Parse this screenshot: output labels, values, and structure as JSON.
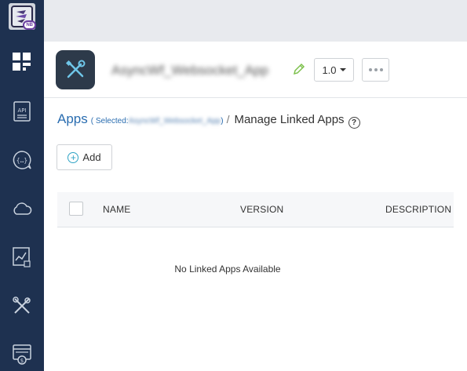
{
  "sidebar": {
    "logo_badge": "NB",
    "items": [
      {
        "icon": "dashboard-icon",
        "label": ""
      },
      {
        "icon": "api-icon",
        "label": "API"
      },
      {
        "icon": "chat-code-icon",
        "label": ""
      },
      {
        "icon": "cloud-icon",
        "label": ""
      },
      {
        "icon": "analytics-icon",
        "label": ""
      },
      {
        "icon": "tools-icon",
        "label": ""
      },
      {
        "icon": "billing-icon",
        "label": ""
      }
    ]
  },
  "app_header": {
    "app_name": "AsyncWf_Websocket_App",
    "version": "1.0"
  },
  "breadcrumb": {
    "root": "Apps",
    "selected_prefix": "( Selected:",
    "selected_value": "AsyncWf_Websocket_App",
    "selected_suffix": ")",
    "separator": "/",
    "current": "Manage Linked Apps",
    "help": "?"
  },
  "toolbar": {
    "add_label": "Add"
  },
  "table": {
    "columns": [
      "NAME",
      "VERSION",
      "DESCRIPTION"
    ],
    "empty_message": "No Linked Apps Available"
  },
  "colors": {
    "sidebar_bg": "#1e3150",
    "link": "#2a6db0",
    "accent": "#2ea3c5",
    "edit_pencil": "#7cc04b"
  }
}
